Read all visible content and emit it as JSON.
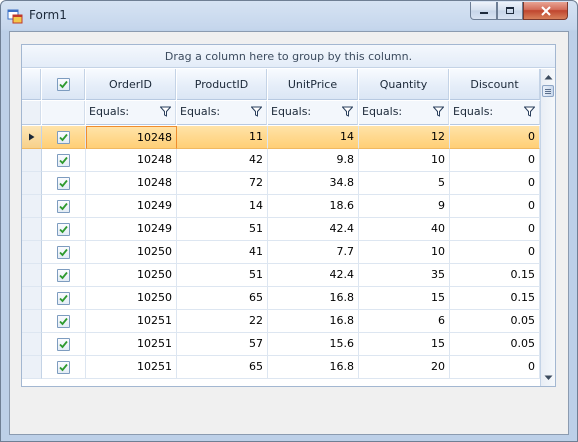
{
  "window": {
    "title": "Form1",
    "icon": "form-app-icon",
    "controls": [
      "minimize-icon",
      "maximize-icon",
      "close-icon"
    ]
  },
  "grid": {
    "group_panel_text": "Drag a column here to group by this column.",
    "columns": [
      "OrderID",
      "ProductID",
      "UnitPrice",
      "Quantity",
      "Discount"
    ],
    "filter_label": "Equals:",
    "selected_row_index": 0,
    "rows": [
      {
        "checked": true,
        "OrderID": "10248",
        "ProductID": "11",
        "UnitPrice": "14",
        "Quantity": "12",
        "Discount": "0"
      },
      {
        "checked": true,
        "OrderID": "10248",
        "ProductID": "42",
        "UnitPrice": "9.8",
        "Quantity": "10",
        "Discount": "0"
      },
      {
        "checked": true,
        "OrderID": "10248",
        "ProductID": "72",
        "UnitPrice": "34.8",
        "Quantity": "5",
        "Discount": "0"
      },
      {
        "checked": true,
        "OrderID": "10249",
        "ProductID": "14",
        "UnitPrice": "18.6",
        "Quantity": "9",
        "Discount": "0"
      },
      {
        "checked": true,
        "OrderID": "10249",
        "ProductID": "51",
        "UnitPrice": "42.4",
        "Quantity": "40",
        "Discount": "0"
      },
      {
        "checked": true,
        "OrderID": "10250",
        "ProductID": "41",
        "UnitPrice": "7.7",
        "Quantity": "10",
        "Discount": "0"
      },
      {
        "checked": true,
        "OrderID": "10250",
        "ProductID": "51",
        "UnitPrice": "42.4",
        "Quantity": "35",
        "Discount": "0.15"
      },
      {
        "checked": true,
        "OrderID": "10250",
        "ProductID": "65",
        "UnitPrice": "16.8",
        "Quantity": "15",
        "Discount": "0.15"
      },
      {
        "checked": true,
        "OrderID": "10251",
        "ProductID": "22",
        "UnitPrice": "16.8",
        "Quantity": "6",
        "Discount": "0.05"
      },
      {
        "checked": true,
        "OrderID": "10251",
        "ProductID": "57",
        "UnitPrice": "15.6",
        "Quantity": "15",
        "Discount": "0.05"
      },
      {
        "checked": true,
        "OrderID": "10251",
        "ProductID": "65",
        "UnitPrice": "16.8",
        "Quantity": "20",
        "Discount": "0"
      }
    ],
    "colors": {
      "selected_row": "#ffcf76",
      "header": "#dbe6f5",
      "checkbox_check": "#2e9a2e"
    }
  }
}
